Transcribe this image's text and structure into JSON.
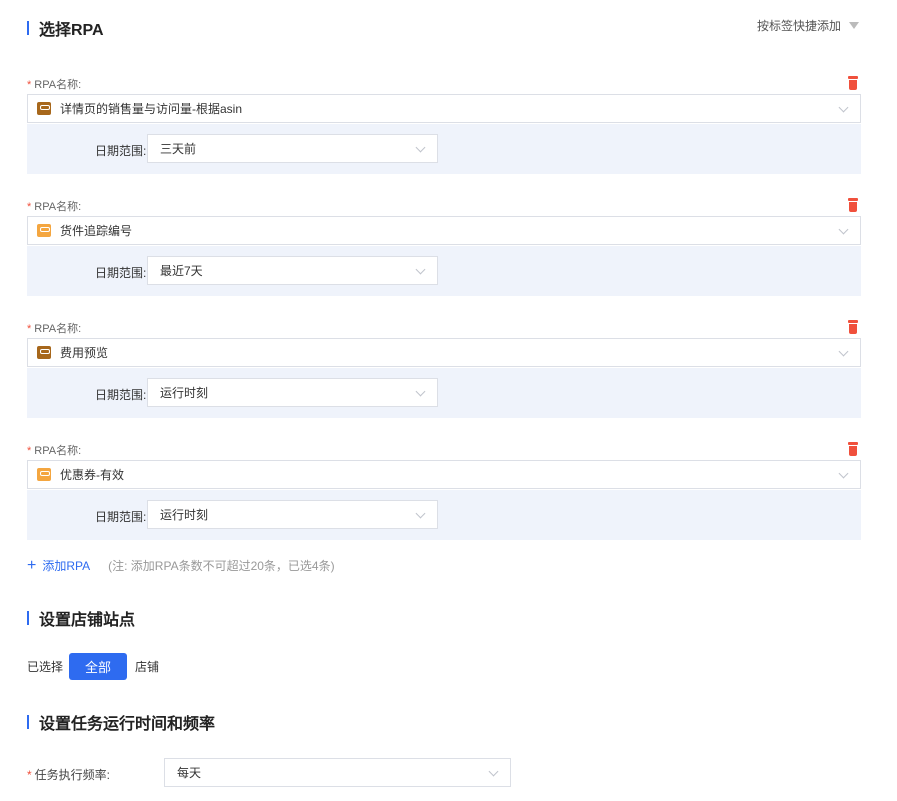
{
  "sections": {
    "rpa_title": "选择RPA",
    "store_title": "设置店铺站点",
    "schedule_title": "设置任务运行时间和频率"
  },
  "quick_add_label": "按标签快捷添加",
  "rpa_items": [
    {
      "label": "RPA名称:",
      "name": "详情页的销售量与访问量-根据asin",
      "icon": "brown",
      "date_label": "日期范围:",
      "date_value": "三天前"
    },
    {
      "label": "RPA名称:",
      "name": "货件追踪编号",
      "icon": "orange",
      "date_label": "日期范围:",
      "date_value": "最近7天"
    },
    {
      "label": "RPA名称:",
      "name": "费用预览",
      "icon": "brown",
      "date_label": "日期范围:",
      "date_value": "运行时刻"
    },
    {
      "label": "RPA名称:",
      "name": "优惠券-有效",
      "icon": "orange",
      "date_label": "日期范围:",
      "date_value": "运行时刻"
    }
  ],
  "required_mark": "*",
  "add_rpa": {
    "plus": "+",
    "label": "添加RPA",
    "note": "(注: 添加RPA条数不可超过20条，已选4条)"
  },
  "store": {
    "prefix": "已选择",
    "button": "全部",
    "suffix": "店铺"
  },
  "frequency": {
    "label": "任务执行频率:",
    "value": "每天"
  },
  "colors": {
    "accent": "#2e6bf0",
    "danger": "#f0503c",
    "panel_bg": "#eff3fb"
  }
}
